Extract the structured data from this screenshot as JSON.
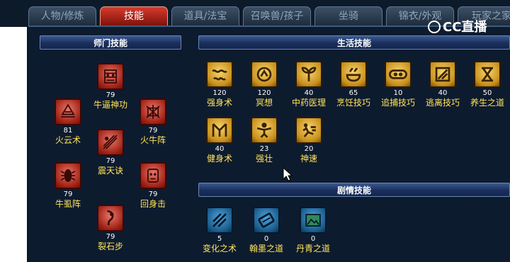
{
  "tabs": [
    {
      "label": "人物/修炼",
      "active": false
    },
    {
      "label": "技能",
      "active": true
    },
    {
      "label": "道具/法宝",
      "active": false
    },
    {
      "label": "召唤兽/孩子",
      "active": false
    },
    {
      "label": "坐骑",
      "active": false
    },
    {
      "label": "锦衣/外观",
      "active": false
    },
    {
      "label": "玩家之家",
      "active": false
    }
  ],
  "watermark": {
    "text": "CC直播"
  },
  "sections": {
    "school": {
      "title": "师门技能",
      "skills": [
        {
          "name": "牛逼神功",
          "level": "79",
          "icon": "bull-mask-icon"
        },
        {
          "name": "火云术",
          "level": "81",
          "icon": "fire-cloud-icon"
        },
        {
          "name": "火牛阵",
          "level": "79",
          "icon": "bull-formation-icon"
        },
        {
          "name": "震天诀",
          "level": "79",
          "icon": "shake-heaven-icon"
        },
        {
          "name": "牛虱阵",
          "level": "79",
          "icon": "louse-formation-icon"
        },
        {
          "name": "回身击",
          "level": "79",
          "icon": "counter-strike-icon"
        },
        {
          "name": "裂石步",
          "level": "79",
          "icon": "rock-split-step-icon"
        }
      ]
    },
    "life": {
      "title": "生活技能",
      "skills": [
        {
          "name": "强身术",
          "level": "120",
          "icon": "strengthen-body-icon"
        },
        {
          "name": "冥想",
          "level": "120",
          "icon": "meditation-icon"
        },
        {
          "name": "中药医理",
          "level": "40",
          "icon": "herbal-medicine-icon"
        },
        {
          "name": "烹饪技巧",
          "level": "65",
          "icon": "cooking-icon"
        },
        {
          "name": "追捕技巧",
          "level": "10",
          "icon": "pursuit-icon"
        },
        {
          "name": "逃离技巧",
          "level": "40",
          "icon": "escape-icon"
        },
        {
          "name": "养生之道",
          "level": "50",
          "icon": "health-preservation-icon"
        },
        {
          "name": "健身术",
          "level": "40",
          "icon": "fitness-icon"
        },
        {
          "name": "强壮",
          "level": "23",
          "icon": "robust-icon"
        },
        {
          "name": "神速",
          "level": "20",
          "icon": "divine-speed-icon"
        }
      ]
    },
    "story": {
      "title": "剧情技能",
      "skills": [
        {
          "name": "变化之术",
          "level": "5",
          "icon": "transformation-icon"
        },
        {
          "name": "翰墨之道",
          "level": "0",
          "icon": "calligraphy-icon"
        },
        {
          "name": "丹青之道",
          "level": "0",
          "icon": "painting-icon"
        }
      ]
    }
  }
}
